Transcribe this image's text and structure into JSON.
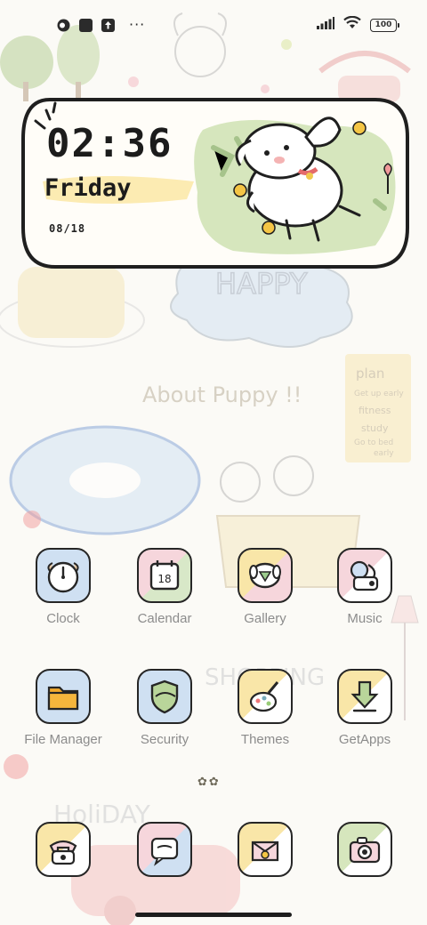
{
  "status_bar": {
    "battery": "100",
    "overflow": "···",
    "left_icons": [
      "notification-circle-icon",
      "app-square-icon",
      "upload-icon"
    ],
    "right_icons": [
      "signal-icon",
      "wifi-icon",
      "battery-icon"
    ]
  },
  "widget": {
    "time": "02:36",
    "day": "Friday",
    "date": "08/18"
  },
  "apps": [
    {
      "label": "Clock",
      "icon": "clock-icon"
    },
    {
      "label": "Calendar",
      "icon": "calendar-icon",
      "badge": "18"
    },
    {
      "label": "Gallery",
      "icon": "gallery-icon"
    },
    {
      "label": "Music",
      "icon": "music-icon"
    },
    {
      "label": "File Manager",
      "icon": "folder-icon"
    },
    {
      "label": "Security",
      "icon": "shield-icon"
    },
    {
      "label": "Themes",
      "icon": "palette-icon"
    },
    {
      "label": "GetApps",
      "icon": "download-icon"
    }
  ],
  "dock": [
    {
      "icon": "phone-icon"
    },
    {
      "icon": "messages-icon"
    },
    {
      "icon": "browser-icon"
    },
    {
      "icon": "camera-icon"
    }
  ],
  "pager": "✿✿",
  "colors": {
    "accent_green": "#c9ddb0",
    "accent_blue": "#cfe0f2",
    "accent_pink": "#f6d6dc",
    "accent_yellow": "#f9e6a8"
  }
}
